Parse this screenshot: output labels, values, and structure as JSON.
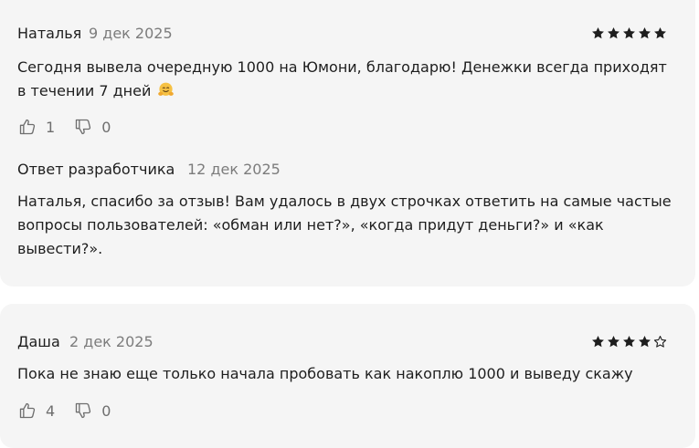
{
  "reviews": [
    {
      "author": "Наталья",
      "date": "9 дек 2025",
      "rating": 5,
      "text_line1": "Сегодня вывела очередную 1000 на Юмони, благодарю! Денежки всегда приходят",
      "text_line2": "в течении 7 дней",
      "emoji": "hugging-face",
      "likes": "1",
      "dislikes": "0",
      "reply": {
        "author": "Ответ разработчика",
        "date": "12 дек 2025",
        "text_line1": "Наталья, спасибо за отзыв! Вам удалось в двух строчках ответить на самые частые",
        "text_line2": "вопросы пользователей: «обман или нет?», «когда придут деньги?» и «как",
        "text_line3": "вывести?»."
      }
    },
    {
      "author": "Даша",
      "date": "2 дек 2025",
      "rating": 4,
      "text": "Пока не знаю еще только начала пробовать как накоплю 1000 и выведу скажу",
      "likes": "4",
      "dislikes": "0"
    }
  ],
  "colors": {
    "card_background": "#f5f5f5",
    "text": "#1e1e1e",
    "muted": "#7c7c7c",
    "star_filled": "#1e1e1e"
  },
  "icons": {
    "star_filled": "star-filled-icon",
    "star_empty": "star-outline-icon",
    "like": "thumbs-up-icon",
    "dislike": "thumbs-down-icon"
  }
}
